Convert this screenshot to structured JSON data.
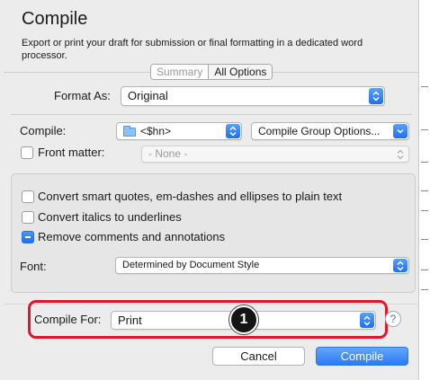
{
  "dialog": {
    "title": "Compile",
    "subtitle": "Export or print your draft for submission or final formatting in a dedicated word processor.",
    "tabs": [
      {
        "label": "Summary",
        "selected": true
      },
      {
        "label": "All Options",
        "selected": false
      }
    ]
  },
  "format": {
    "label": "Format As:",
    "value": "Original"
  },
  "compile": {
    "label": "Compile:",
    "value": "<$hn>",
    "group_options": "Compile Group Options..."
  },
  "front_matter": {
    "label": "Front matter:",
    "value": "- None -",
    "checked": false
  },
  "options": [
    {
      "label": "Convert smart quotes, em-dashes and ellipses to plain text",
      "state": "unchecked"
    },
    {
      "label": "Convert italics to underlines",
      "state": "unchecked"
    },
    {
      "label": "Remove comments and annotations",
      "state": "mixed"
    }
  ],
  "font": {
    "label": "Font:",
    "value": "Determined by Document Style"
  },
  "compile_for": {
    "label": "Compile For:",
    "value": "Print"
  },
  "callout": {
    "number": "1"
  },
  "help": {
    "glyph": "?"
  },
  "buttons": {
    "cancel": "Cancel",
    "compile": "Compile"
  },
  "colors": {
    "accent": "#2a7bf3",
    "highlight": "#e3152c",
    "badge": "#141414"
  }
}
